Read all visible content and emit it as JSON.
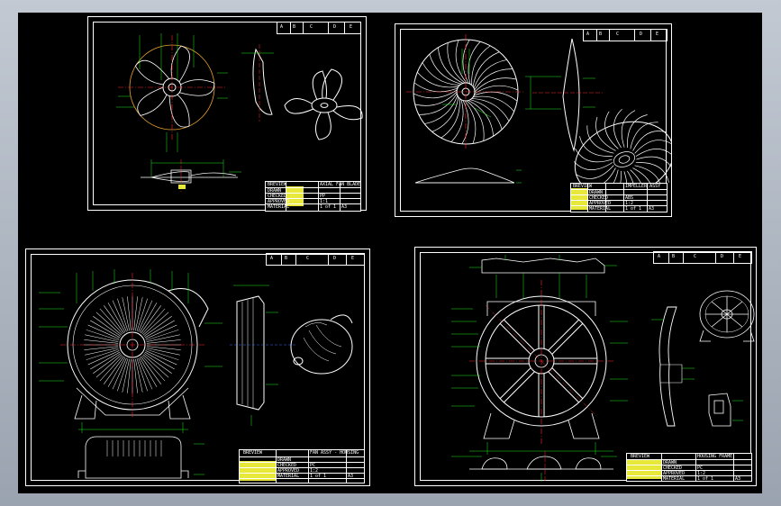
{
  "sheets": [
    {
      "id": "axial-fan-blade",
      "revision_block": {
        "cells": [
          "A",
          "B",
          "C",
          "D",
          "E"
        ]
      },
      "title_block": {
        "company": "BREVIEW",
        "drawing_title": "AXIAL FAN BLADE",
        "fields": [
          "DRAWN",
          "CHECKED",
          "APPROVED",
          "MATERIAL",
          "SCALE"
        ],
        "values": [
          "PP",
          "1:1",
          "A3"
        ],
        "sheet": "1 of 1"
      }
    },
    {
      "id": "centrifugal-impeller",
      "revision_block": {
        "cells": [
          "A",
          "B",
          "C",
          "D",
          "E"
        ]
      },
      "title_block": {
        "company": "BREVIEW",
        "drawing_title": "IMPELLER ASSY",
        "fields": [
          "DRAWN",
          "CHECKED",
          "APPROVED",
          "MATERIAL",
          "SCALE"
        ],
        "values": [
          "ABS",
          "1:2",
          "A3"
        ],
        "sheet": "1 of 1"
      }
    },
    {
      "id": "fan-housing-assembly",
      "revision_block": {
        "cells": [
          "A",
          "B",
          "C",
          "D",
          "E"
        ]
      },
      "title_block": {
        "company": "BREVIEW",
        "drawing_title": "FAN ASSY - HOUSING",
        "fields": [
          "DRAWN",
          "CHECKED",
          "APPROVED",
          "MATERIAL",
          "SCALE"
        ],
        "values": [
          "PC",
          "1:2",
          "A3"
        ],
        "sheet": "1 of 1"
      }
    },
    {
      "id": "fan-housing-frame",
      "revision_block": {
        "cells": [
          "A",
          "B",
          "C",
          "D",
          "E"
        ]
      },
      "title_block": {
        "company": "BREVIEW",
        "drawing_title": "HOUSING FRAME",
        "fields": [
          "DRAWN",
          "CHECKED",
          "APPROVED",
          "MATERIAL",
          "SCALE"
        ],
        "values": [
          "PC",
          "1:2",
          "A3"
        ],
        "sheet": "1 of 1"
      }
    }
  ],
  "colors": {
    "background": "#000000",
    "linework": "#ffffff",
    "dimension": "#22e822",
    "centerline": "#ff2a2a",
    "highlight": "#e8e83a",
    "hidden": "#3a6cff",
    "frame": "#aeb6c1"
  }
}
